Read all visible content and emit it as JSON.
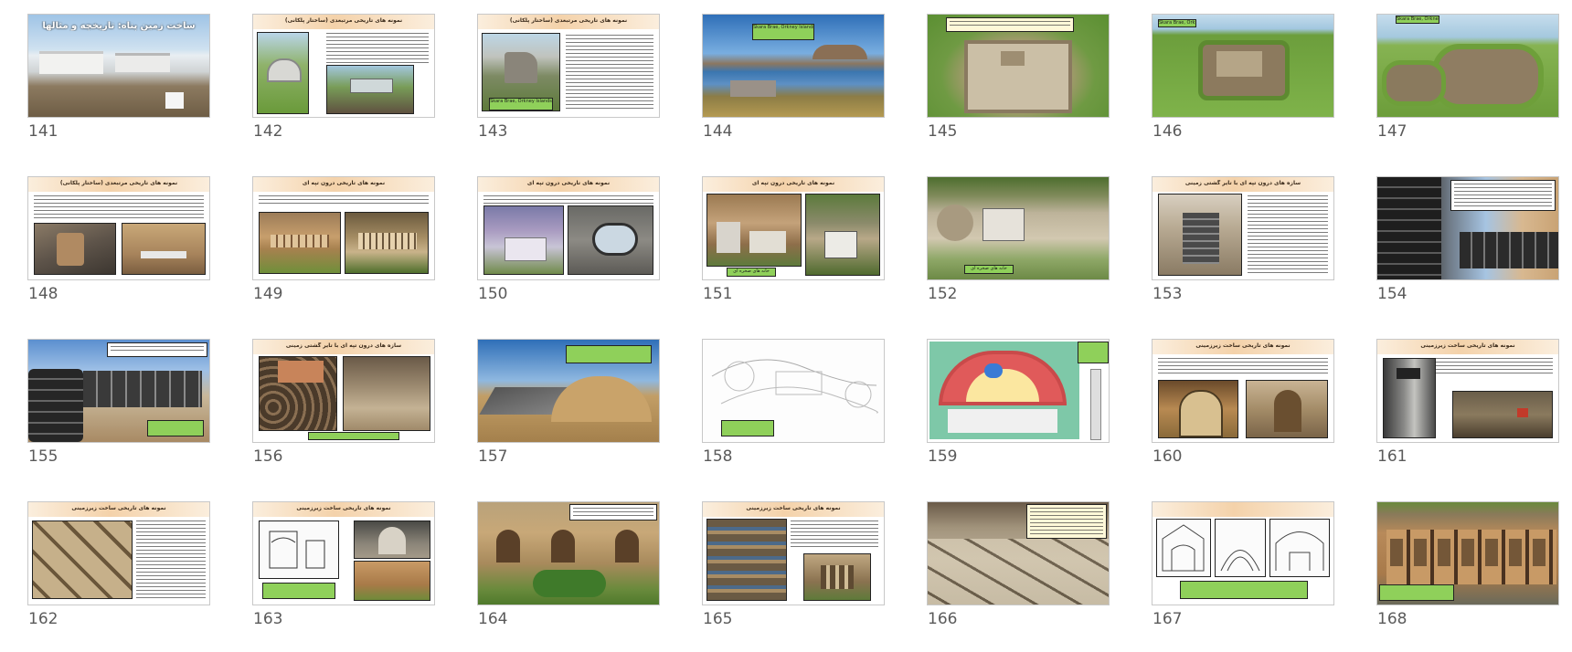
{
  "slides": [
    {
      "number": "141",
      "title": "ساخت زمین پناه: تاریخچه و مثالها"
    },
    {
      "number": "142",
      "title": "نمونه های تاریخی مرتبعدی (ساختار پلکانی)"
    },
    {
      "number": "143",
      "title": "نمونه های تاریخی مرتبعدی (ساختار پلکانی)",
      "caption": "Skara Brae, Orkney Islands"
    },
    {
      "number": "144",
      "caption": "Skara Brae, Orkney Islands"
    },
    {
      "number": "145"
    },
    {
      "number": "146",
      "caption": "Skara Brae, Orkney Islands"
    },
    {
      "number": "147",
      "caption": "Skara Brae, Orkney Islands"
    },
    {
      "number": "148",
      "title": "نمونه های تاریخی مرتبعدی (ساختار پلکانی)"
    },
    {
      "number": "149",
      "title": "نمونه های تاریخی درون تپه ای"
    },
    {
      "number": "150",
      "title": "نمونه های تاریخی درون تپه ای"
    },
    {
      "number": "151",
      "title": "نمونه های تاریخی درون تپه ای",
      "caption": "خانه های صخره ای"
    },
    {
      "number": "152",
      "caption": "خانه های صخره ای"
    },
    {
      "number": "153",
      "title": "سازه های درون تپه ای با تایر گشتی زمینی"
    },
    {
      "number": "154"
    },
    {
      "number": "155"
    },
    {
      "number": "156",
      "title": "سازه های درون تپه ای با تایر گشتی زمینی"
    },
    {
      "number": "157"
    },
    {
      "number": "158"
    },
    {
      "number": "159"
    },
    {
      "number": "160",
      "title": "نمونه های تاریخی ساخت زیرزمینی"
    },
    {
      "number": "161",
      "title": "نمونه های تاریخی ساخت زیرزمینی"
    },
    {
      "number": "162",
      "title": "نمونه های تاریخی ساخت زیرزمینی"
    },
    {
      "number": "163",
      "title": "نمونه های تاریخی ساخت زیرزمینی"
    },
    {
      "number": "164"
    },
    {
      "number": "165",
      "title": "نمونه های تاریخی ساخت زیرزمینی"
    },
    {
      "number": "166"
    },
    {
      "number": "167"
    },
    {
      "number": "168"
    }
  ]
}
